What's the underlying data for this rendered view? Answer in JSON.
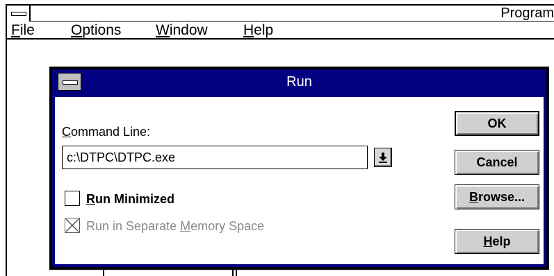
{
  "parent_window": {
    "title": "Program",
    "menu": [
      {
        "label": "File",
        "accel": "F",
        "rest": "ile"
      },
      {
        "label": "Options",
        "accel": "O",
        "rest": "ptions"
      },
      {
        "label": "Window",
        "accel": "W",
        "rest": "indow"
      },
      {
        "label": "Help",
        "accel": "H",
        "rest": "elp"
      }
    ]
  },
  "dialog": {
    "title": "Run",
    "command_line_label": {
      "accel": "C",
      "rest": "ommand Line:"
    },
    "command_line_value": "c:\\DTPC\\DTPC.exe",
    "run_minimized": {
      "accel": "R",
      "rest": "un Minimized",
      "checked": false
    },
    "separate_memory": {
      "before": "Run in Separate ",
      "accel": "M",
      "rest": "emory Space",
      "checked": true,
      "disabled": true
    },
    "buttons": {
      "ok": "OK",
      "cancel": "Cancel",
      "browse": {
        "accel": "B",
        "rest": "rowse..."
      },
      "help": {
        "accel": "H",
        "rest": "elp"
      }
    }
  },
  "icons": {
    "system_menu": "system-menu-icon",
    "dropdown": "down-arrow-icon"
  }
}
